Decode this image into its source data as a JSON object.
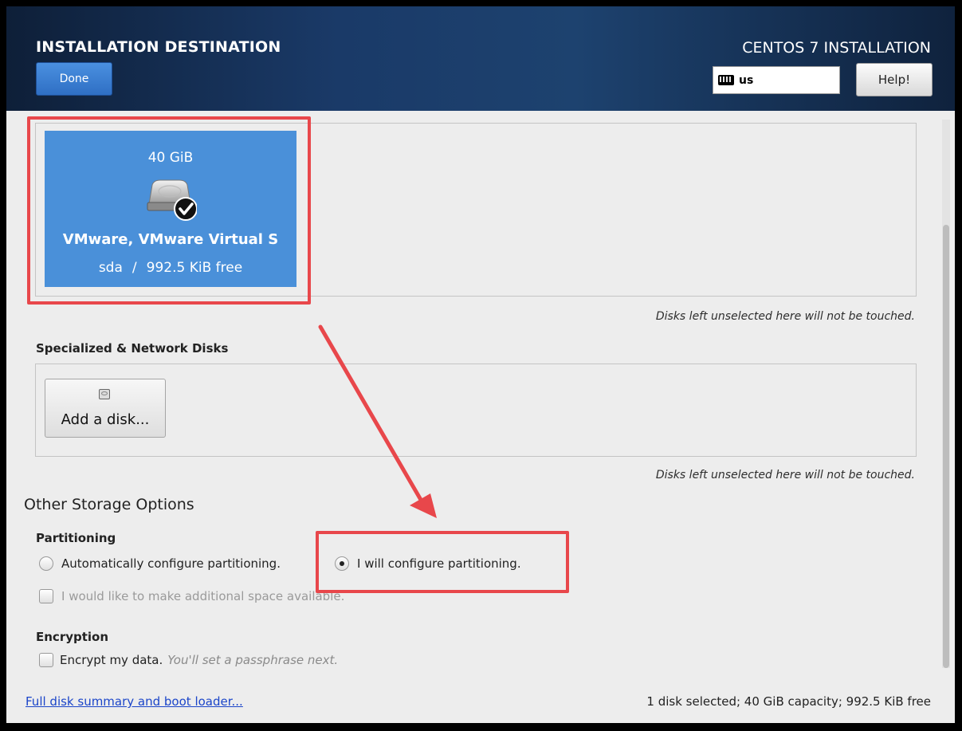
{
  "header": {
    "title": "INSTALLATION DESTINATION",
    "done_label": "Done",
    "product": "CENTOS 7 INSTALLATION",
    "keyboard_layout": "us",
    "help_label": "Help!"
  },
  "local_disks": {
    "disks": [
      {
        "size": "40 GiB",
        "name": "VMware, VMware Virtual S",
        "device": "sda",
        "separator": "/",
        "free": "992.5 KiB free",
        "selected": true
      }
    ],
    "hint": "Disks left unselected here will not be touched."
  },
  "network_disks": {
    "label": "Specialized & Network Disks",
    "add_label": "Add a disk...",
    "hint": "Disks left unselected here will not be touched."
  },
  "other_storage": {
    "title": "Other Storage Options",
    "partitioning": {
      "label": "Partitioning",
      "auto_label": "Automatically configure partitioning.",
      "manual_label": "I will configure partitioning.",
      "selected": "manual",
      "space_label": "I would like to make additional space available."
    },
    "encryption": {
      "label": "Encryption",
      "encrypt_label": "Encrypt my data.",
      "encrypt_hint": "You'll set a passphrase next."
    }
  },
  "footer": {
    "link": "Full disk summary and boot loader...",
    "status": "1 disk selected; 40 GiB capacity; 992.5 KiB free"
  },
  "colors": {
    "header_bg": "#1a3a68",
    "disk_selected": "#4a90d9",
    "annotation": "#e8474b",
    "link": "#1b45c9"
  }
}
